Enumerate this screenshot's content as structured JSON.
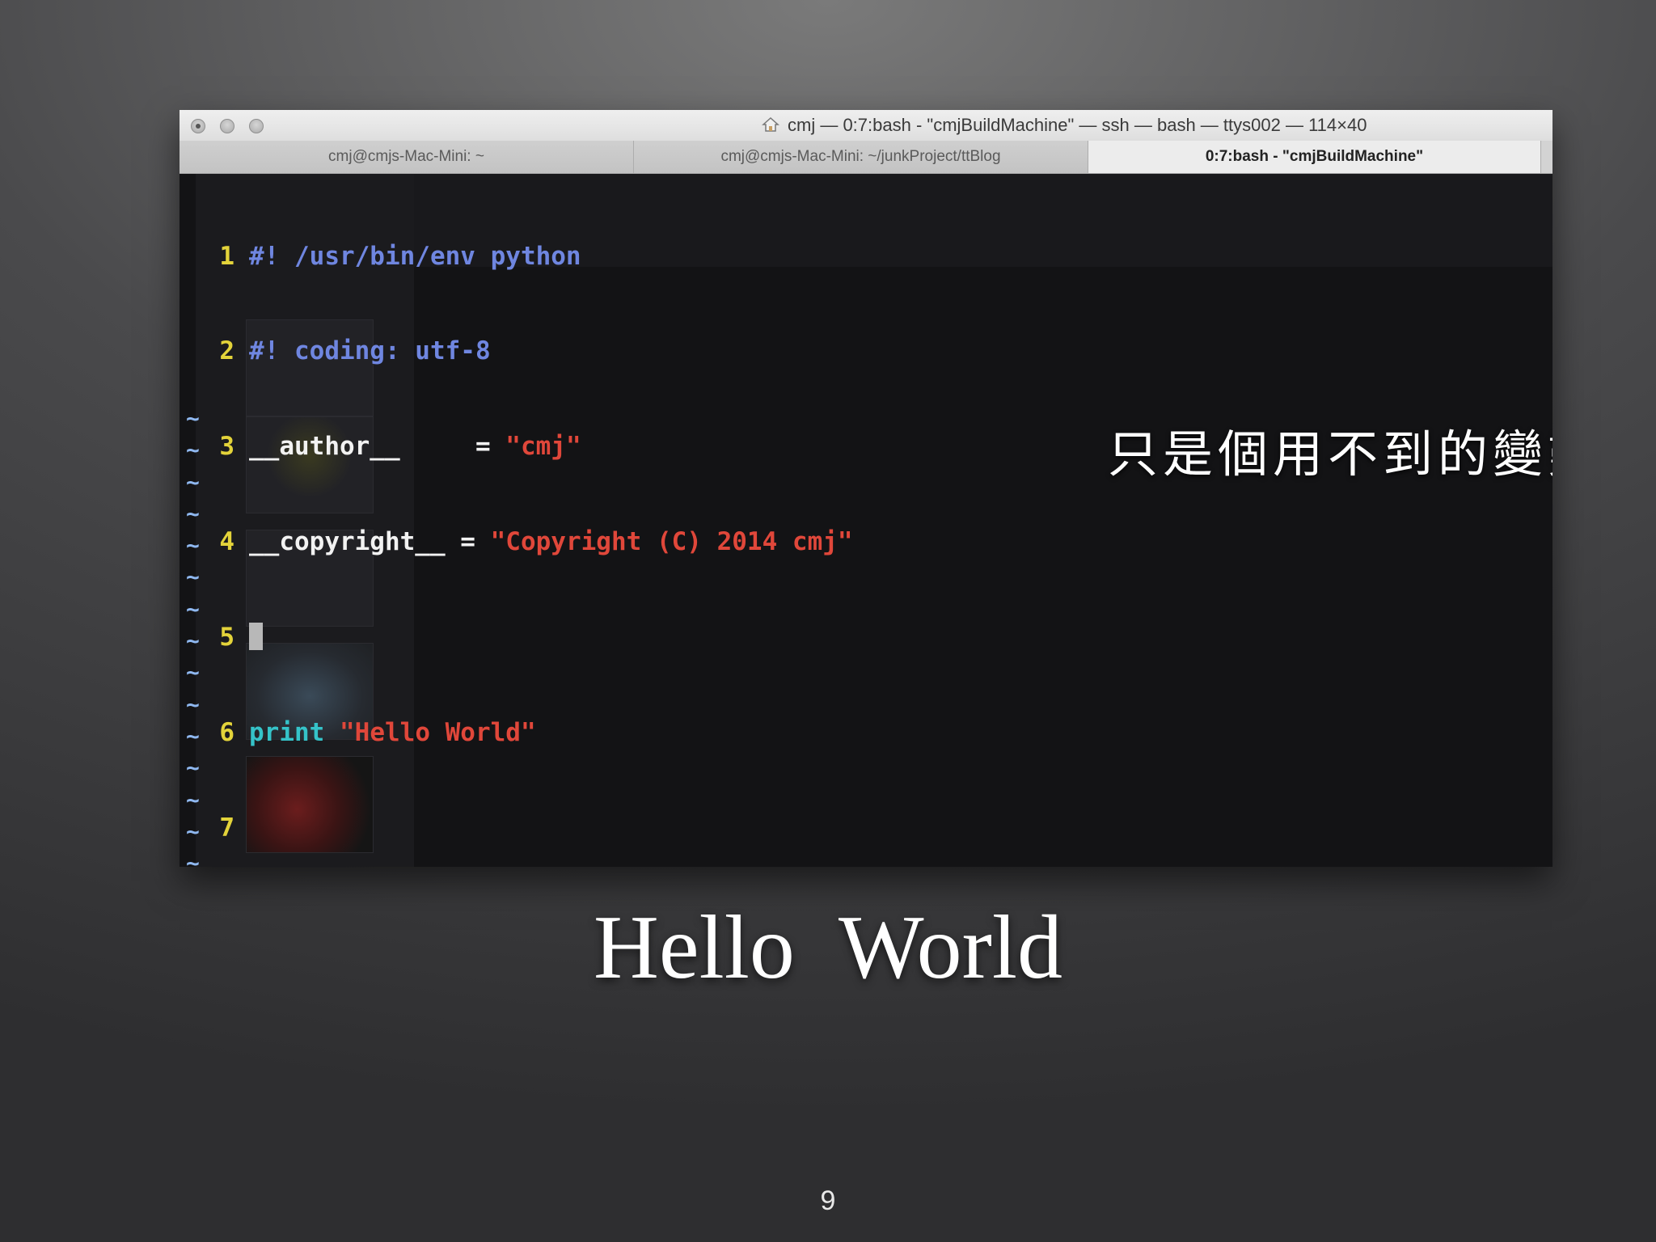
{
  "window": {
    "title": "cmj — 0:7:bash - \"cmjBuildMachine\" — ssh — bash — ttys002 — 114×40",
    "tabs": [
      {
        "label": "cmj@cmjs-Mac-Mini: ~",
        "active": false
      },
      {
        "label": "cmj@cmjs-Mac-Mini: ~/junkProject/ttBlog",
        "active": false
      },
      {
        "label": "0:7:bash - \"cmjBuildMachine\"",
        "active": true
      }
    ]
  },
  "editor": {
    "line_numbers": [
      "1",
      "2",
      "3",
      "4",
      "5",
      "6",
      "7"
    ],
    "lines": {
      "l1": "#! /usr/bin/env python",
      "l2": "#! coding: utf-8",
      "l3_name": "__author__",
      "l3_eq": "     = ",
      "l3_val": "\"cmj\"",
      "l4_name": "__copyright__",
      "l4_eq": " = ",
      "l4_val": "\"Copyright (C) 2014 cmj\"",
      "l6_kw": "print",
      "l6_val": "\"Hello World\""
    },
    "empty_line_marker": "~",
    "empty_line_count": 15,
    "colors": {
      "line_number": "#e3d33a",
      "comment": "#6f86e0",
      "string": "#e0473a",
      "keyword": "#35c3c9",
      "tilde": "#8fb8f0"
    }
  },
  "overlay_note": "只是個用不到的變數",
  "slide": {
    "title": "Hello World",
    "page_number": "9"
  }
}
